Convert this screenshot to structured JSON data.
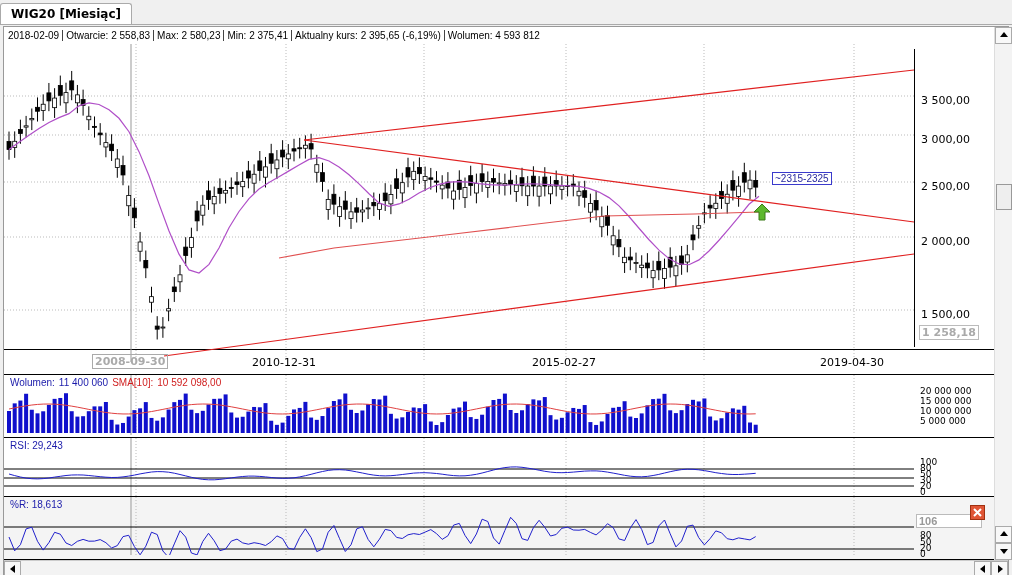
{
  "tabs": [
    {
      "label": "WIG20 [Miesiąc]",
      "selected": true
    }
  ],
  "info_bar": [
    "2018-02-09",
    "Otwarcie: 2 558,83",
    "Max: 2 580,23",
    "Min: 2 375,41",
    "Aktualny kurs: 2 395,65 (-6,19%)",
    "Wolumen: 4 593 812"
  ],
  "price_axis": {
    "ticks": [
      "3 500,00",
      "3 000,00",
      "2 500,00",
      "2 000,00",
      "1 500,00"
    ],
    "cursor_value": "1 258,18"
  },
  "annotation": "~2315-2325",
  "date_axis": {
    "cursor_date": "2008-09-30",
    "dates": [
      "2010-12-31",
      "2015-02-27",
      "2019-04-30"
    ]
  },
  "volume_panel": {
    "label": "Wolumen:",
    "value": "11 400 060",
    "sma_label": "SMA[10]:",
    "sma_value": "10 592 098,00",
    "ticks": [
      "20 000 000",
      "15 000 000",
      "10 000 000",
      "5 000 000"
    ]
  },
  "rsi_panel": {
    "label": "RSI: 29,243",
    "ticks": [
      "100",
      "80",
      "50",
      "30",
      "20",
      "0"
    ]
  },
  "wr_panel": {
    "label": "%R: 18,613",
    "ticks": [
      "80",
      "50",
      "20",
      "0"
    ],
    "input_value": "106"
  }
}
